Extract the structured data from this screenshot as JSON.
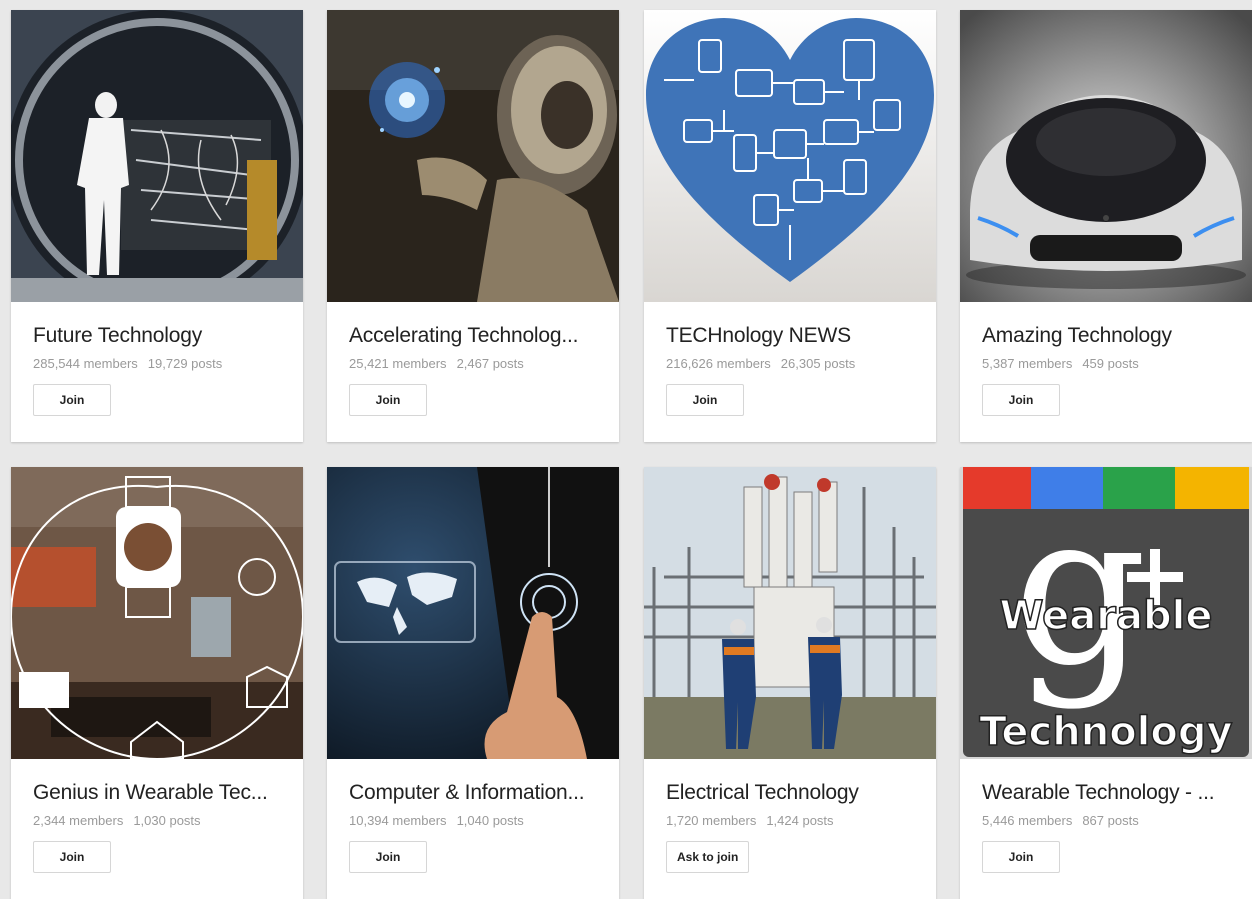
{
  "communities": [
    {
      "title": "Future Technology",
      "members": "285,544 members",
      "posts": "19,729 posts",
      "button": "Join",
      "image": "space-chamber-photo"
    },
    {
      "title": "Accelerating Technolog...",
      "members": "25,421 members",
      "posts": "2,467 posts",
      "button": "Join",
      "image": "robot-photo"
    },
    {
      "title": "TECHnology NEWS",
      "members": "216,626 members",
      "posts": "26,305 posts",
      "button": "Join",
      "image": "heart-devices-illustration"
    },
    {
      "title": "Amazing Technology",
      "members": "5,387 members",
      "posts": "459 posts",
      "button": "Join",
      "image": "concept-car-photo"
    },
    {
      "title": "Genius in Wearable Tec...",
      "members": "2,344 members",
      "posts": "1,030 posts",
      "button": "Join",
      "image": "smart-home-photo"
    },
    {
      "title": "Computer & Information...",
      "members": "10,394 members",
      "posts": "1,040 posts",
      "button": "Join",
      "image": "touch-world-map-photo"
    },
    {
      "title": "Electrical Technology",
      "members": "1,720 members",
      "posts": "1,424 posts",
      "button": "Ask to join",
      "image": "substation-workers-photo"
    },
    {
      "title": "Wearable Technology - ...",
      "members": "5,446 members",
      "posts": "867 posts",
      "button": "Join",
      "image": "gplus-wearable-logo",
      "logo_text_1": "Wearable",
      "logo_text_2": "Technology"
    }
  ],
  "colors": {
    "background": "#e8e8e8",
    "card": "#ffffff",
    "heart_blue": "#3f74b8",
    "gplus_red": "#e53a2b",
    "gplus_blue": "#3f7ee8",
    "gplus_green": "#2aa24a",
    "gplus_yellow": "#f4b400"
  }
}
